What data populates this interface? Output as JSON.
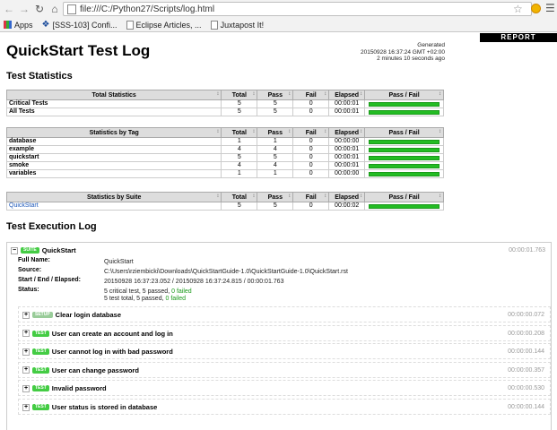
{
  "browser": {
    "url": "file:///C:/Python27/Scripts/log.html",
    "bookmarks": [
      "Apps",
      "[SSS-103] Confi...",
      "Eclipse Articles, ...",
      "Juxtapost It!"
    ]
  },
  "report": {
    "badge": "REPORT",
    "title": "QuickStart Test Log",
    "generated_label": "Generated",
    "generated_time": "20150928 16:37:24 GMT +02:00",
    "generated_ago": "2 minutes 10 seconds ago"
  },
  "stats": {
    "heading": "Test Statistics",
    "columns": [
      "Total",
      "Pass",
      "Fail",
      "Elapsed",
      "Pass / Fail"
    ],
    "tables": [
      {
        "title": "Total Statistics",
        "rows": [
          {
            "name": "Critical Tests",
            "total": "5",
            "pass": "5",
            "fail": "0",
            "elapsed": "00:00:01",
            "pass_fraction": 1.0
          },
          {
            "name": "All Tests",
            "total": "5",
            "pass": "5",
            "fail": "0",
            "elapsed": "00:00:01",
            "pass_fraction": 1.0
          }
        ]
      },
      {
        "title": "Statistics by Tag",
        "rows": [
          {
            "name": "database",
            "total": "1",
            "pass": "1",
            "fail": "0",
            "elapsed": "00:00:00",
            "pass_fraction": 1.0
          },
          {
            "name": "example",
            "total": "4",
            "pass": "4",
            "fail": "0",
            "elapsed": "00:00:01",
            "pass_fraction": 1.0
          },
          {
            "name": "quickstart",
            "total": "5",
            "pass": "5",
            "fail": "0",
            "elapsed": "00:00:01",
            "pass_fraction": 1.0
          },
          {
            "name": "smoke",
            "total": "4",
            "pass": "4",
            "fail": "0",
            "elapsed": "00:00:01",
            "pass_fraction": 1.0
          },
          {
            "name": "variables",
            "total": "1",
            "pass": "1",
            "fail": "0",
            "elapsed": "00:00:00",
            "pass_fraction": 1.0
          }
        ]
      },
      {
        "title": "Statistics by Suite",
        "rows": [
          {
            "name": "QuickStart",
            "total": "5",
            "pass": "5",
            "fail": "0",
            "elapsed": "00:00:02",
            "pass_fraction": 1.0,
            "link": true
          }
        ]
      }
    ]
  },
  "execution": {
    "heading": "Test Execution Log",
    "suite": {
      "label": "SUITE",
      "name": "QuickStart",
      "elapsed": "00:00:01.763",
      "full_name_key": "Full Name:",
      "full_name": "QuickStart",
      "source_key": "Source:",
      "source": "C:\\Users\\rziembicki\\Downloads\\QuickStartGuide-1.0\\QuickStartGuide-1.0\\QuickStart.rst",
      "times_key": "Start / End / Elapsed:",
      "times": "20150928 16:37:23.052 / 20150928 16:37:24.815 / 00:00:01.763",
      "status_key": "Status:",
      "status_line1_a": "5 critical test, 5 passed,",
      "status_line1_b": "0 failed",
      "status_line2_a": "5 test total, 5 passed,",
      "status_line2_b": "0 failed"
    },
    "items": [
      {
        "label": "SETUP",
        "name": "Clear login database",
        "elapsed": "00:00:00.072"
      },
      {
        "label": "TEST",
        "name": "User can create an account and log in",
        "elapsed": "00:00:00.208"
      },
      {
        "label": "TEST",
        "name": "User cannot log in with bad password",
        "elapsed": "00:00:00.144"
      },
      {
        "label": "TEST",
        "name": "User can change password",
        "elapsed": "00:00:00.357"
      },
      {
        "label": "TEST",
        "name": "Invalid password",
        "elapsed": "00:00:00.530"
      },
      {
        "label": "TEST",
        "name": "User status is stored in database",
        "elapsed": "00:00:00.144"
      }
    ]
  },
  "colors": {
    "pass_bar": "#23bc23",
    "badge_bg": "#000000",
    "link": "#1a56b8"
  }
}
